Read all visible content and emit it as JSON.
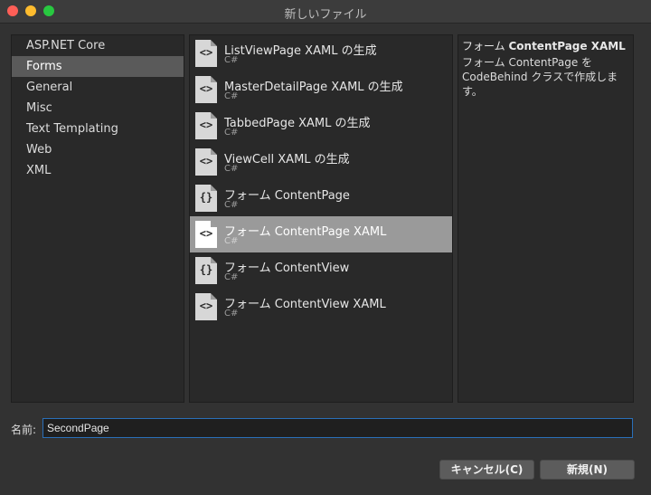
{
  "window": {
    "title": "新しいファイル"
  },
  "categories": {
    "items": [
      {
        "label": "ASP.NET Core"
      },
      {
        "label": "Forms",
        "selected": true
      },
      {
        "label": "General"
      },
      {
        "label": "Misc"
      },
      {
        "label": "Text Templating"
      },
      {
        "label": "Web"
      },
      {
        "label": "XML"
      }
    ]
  },
  "templates": {
    "items": [
      {
        "name": "ListViewPage XAML の生成",
        "lang": "C#",
        "icon": "xaml-code-icon",
        "glyph": "<>"
      },
      {
        "name": "MasterDetailPage XAML の生成",
        "lang": "C#",
        "icon": "xaml-code-icon",
        "glyph": "<>"
      },
      {
        "name": "TabbedPage XAML の生成",
        "lang": "C#",
        "icon": "xaml-code-icon",
        "glyph": "<>"
      },
      {
        "name": "ViewCell XAML の生成",
        "lang": "C#",
        "icon": "xaml-code-icon",
        "glyph": "<>"
      },
      {
        "name": "フォーム ContentPage",
        "lang": "C#",
        "icon": "csharp-code-icon",
        "glyph": "{}"
      },
      {
        "name": "フォーム ContentPage XAML",
        "lang": "C#",
        "icon": "xaml-code-icon",
        "glyph": "<>",
        "selected": true
      },
      {
        "name": "フォーム ContentView",
        "lang": "C#",
        "icon": "csharp-code-icon",
        "glyph": "{}"
      },
      {
        "name": "フォーム ContentView XAML",
        "lang": "C#",
        "icon": "xaml-code-icon",
        "glyph": "<>"
      }
    ]
  },
  "description": {
    "title_prefix": "フォーム ",
    "title_bold": "ContentPage XAML",
    "body": "フォーム ContentPage を CodeBehind クラスで作成します。"
  },
  "name_field": {
    "label": "名前:",
    "value": "SecondPage"
  },
  "buttons": {
    "cancel": "キャンセル(C)",
    "new": "新規(N)"
  },
  "colors": {
    "selection_list": "#5a5a5a",
    "selection_template": "#9a9a9a",
    "focus_border": "#2a6fb8"
  }
}
